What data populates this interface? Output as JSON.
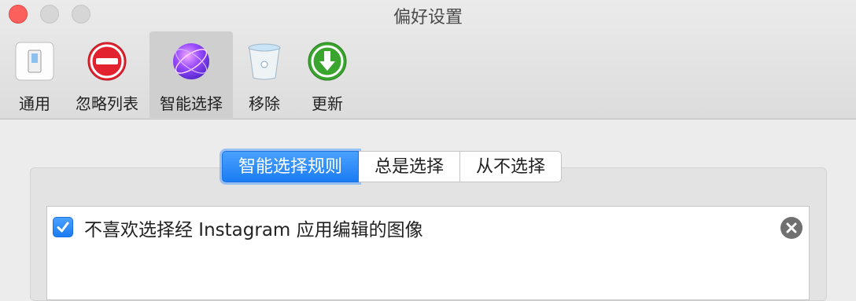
{
  "window": {
    "title": "偏好设置"
  },
  "toolbar": {
    "items": [
      {
        "label": "通用",
        "icon": "general-switch-icon"
      },
      {
        "label": "忽略列表",
        "icon": "no-entry-icon"
      },
      {
        "label": "智能选择",
        "icon": "smart-select-orb-icon",
        "selected": true
      },
      {
        "label": "移除",
        "icon": "trash-bin-icon"
      },
      {
        "label": "更新",
        "icon": "download-arrow-icon"
      }
    ]
  },
  "segments": {
    "items": [
      "智能选择规则",
      "总是选择",
      "从不选择"
    ],
    "selected": "智能选择规则"
  },
  "rules": [
    {
      "text": "不喜欢选择经 Instagram 应用编辑的图像",
      "checked": true
    }
  ],
  "colors": {
    "accent": "#1b7cf2",
    "close_button": "#fc605c",
    "update_green": "#3aa52e",
    "no_entry_red": "#e2232f"
  }
}
